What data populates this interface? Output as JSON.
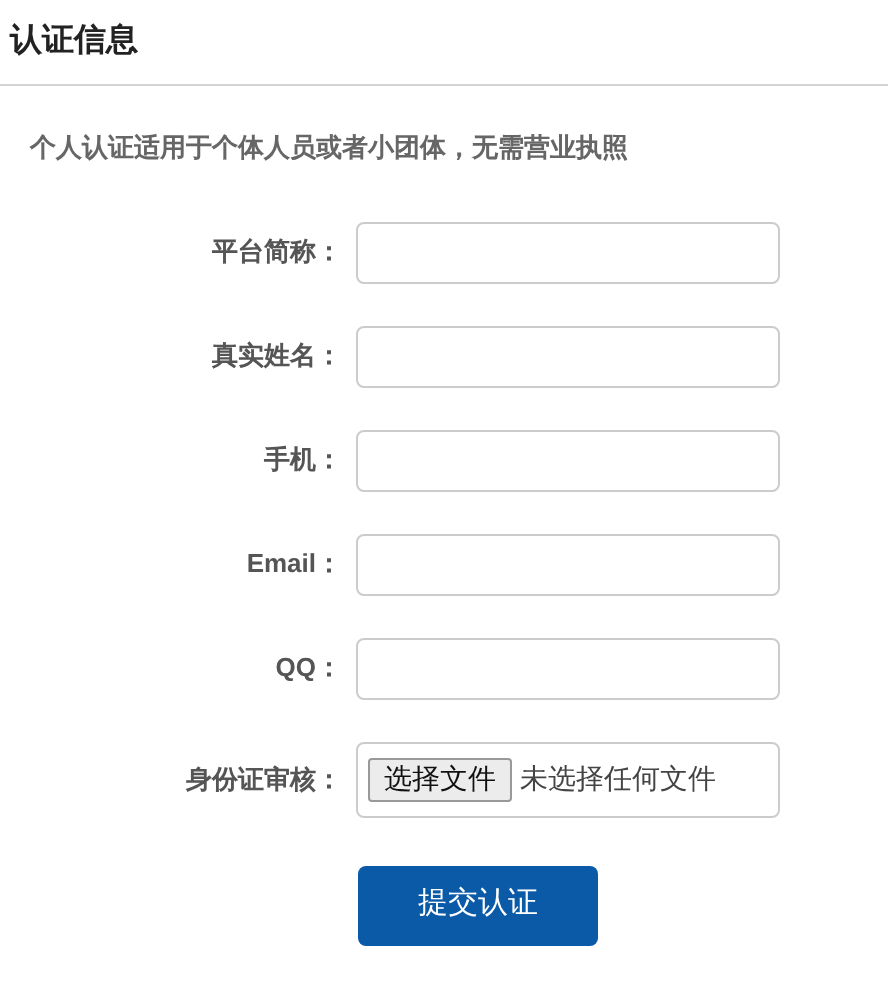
{
  "title": "认证信息",
  "notice": "个人认证适用于个体人员或者小团体，无需营业执照",
  "fields": [
    {
      "kind": "text",
      "label": "平台简称："
    },
    {
      "kind": "text",
      "label": "真实姓名："
    },
    {
      "kind": "text",
      "label": "手机："
    },
    {
      "kind": "text",
      "label": "Email："
    },
    {
      "kind": "text",
      "label": "QQ："
    },
    {
      "kind": "file",
      "label": "身份证审核：",
      "button": "选择文件",
      "value": "未选择任何文件"
    }
  ],
  "submit": "提交认证"
}
